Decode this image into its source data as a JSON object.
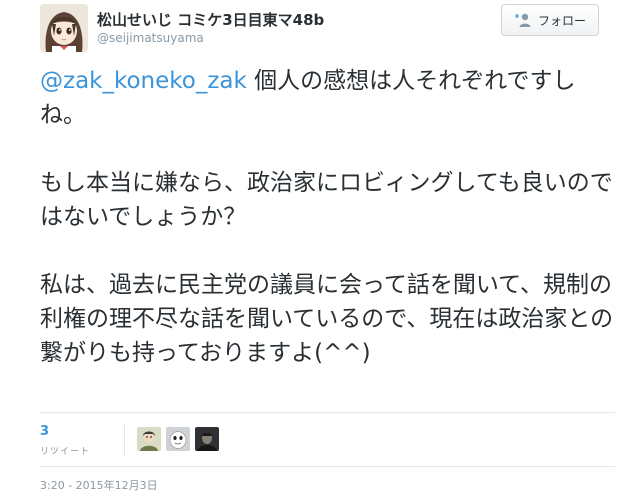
{
  "user": {
    "display_name": "松山せいじ コミケ3日目東マ48b",
    "handle": "@seijimatsuyama",
    "avatar": "anime-girl-avatar-icon"
  },
  "follow_button": {
    "label": "フォロー",
    "icon": "add-user-icon"
  },
  "tweet": {
    "mention": "@zak_koneko_zak",
    "paragraph_1": " 個人の感想は人それぞれですしね。",
    "paragraph_2": "もし本当に嫌なら、政治家にロビィングしても良いのではないでしょうか？",
    "paragraph_3": "私は、過去に民主党の議員に会って話を聞いて、規制の利権の理不尽な話を聞いているので、現在は政治家との繋がりも持っておりますよ(^^)"
  },
  "stats": {
    "retweet_count": "3",
    "retweet_label": "リツイート",
    "retweeters": [
      "retweeter-avatar-1",
      "retweeter-avatar-2",
      "retweeter-avatar-3"
    ]
  },
  "timestamp": "3:20 - 2015年12月3日",
  "colors": {
    "link": "#3b94d9",
    "text": "#292f33",
    "muted": "#8899a6",
    "border": "#e1e8ed"
  }
}
